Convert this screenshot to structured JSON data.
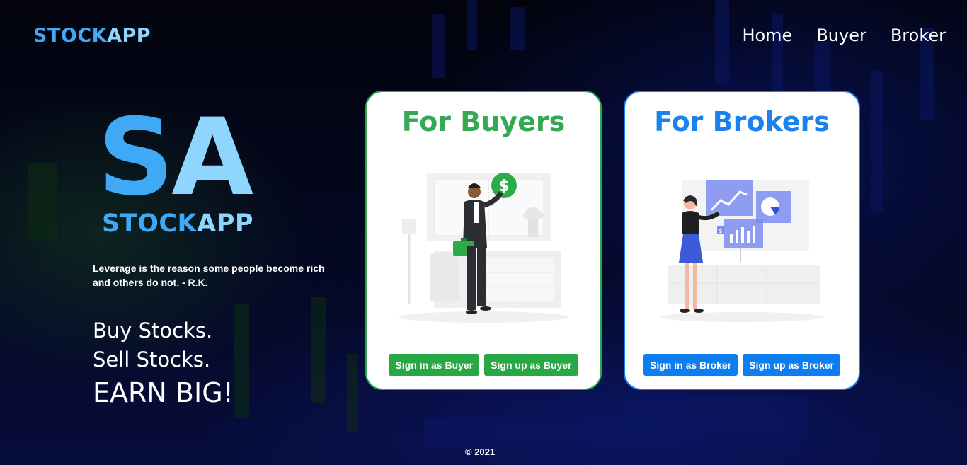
{
  "nav": {
    "brand_part1": "STOCK",
    "brand_part2": "APP",
    "links": [
      "Home",
      "Buyer",
      "Broker"
    ]
  },
  "hero": {
    "logo_initial_1": "S",
    "logo_initial_2": "A",
    "logo_name_part1": "STOCK",
    "logo_name_part2": "APP",
    "quote": "Leverage is the reason some people become rich and others do not. - R.K.",
    "tagline_1": "Buy Stocks.",
    "tagline_2": "Sell Stocks.",
    "tagline_3": "EARN BIG!"
  },
  "cards": {
    "buyer": {
      "title": "For Buyers",
      "sign_in": "Sign in as Buyer",
      "sign_up": "Sign up as Buyer"
    },
    "broker": {
      "title": "For Brokers",
      "sign_in": "Sign in as Broker",
      "sign_up": "Sign up as Broker"
    }
  },
  "footer": {
    "copyright": "© 2021"
  },
  "colors": {
    "brand_blue": "#3fa9f5",
    "brand_light": "#8fd6ff",
    "buyer_green": "#28a745",
    "broker_blue": "#0d7ef0"
  },
  "icons": {
    "buyer_illustration": "businessman-with-money-illustration",
    "broker_illustration": "businesswoman-with-charts-illustration"
  }
}
